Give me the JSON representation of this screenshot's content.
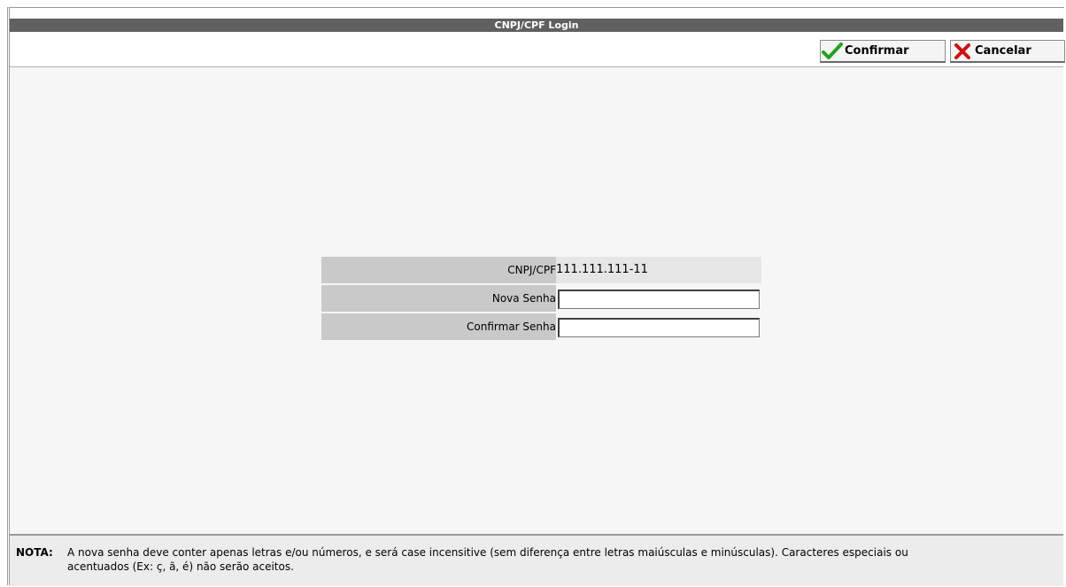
{
  "window": {
    "title": "CNPJ/CPF Login"
  },
  "toolbar": {
    "confirm_label": "Confirmar",
    "cancel_label": "Cancelar",
    "confirm_icon": "check-icon",
    "cancel_icon": "x-icon",
    "confirm_icon_color": "#1fa31f",
    "cancel_icon_color": "#cc1111"
  },
  "form": {
    "cnpj_label": "CNPJ/CPF",
    "cnpj_value": "111.111.111-11",
    "new_password_label": "Nova Senha",
    "new_password_value": "",
    "confirm_password_label": "Confirmar Senha",
    "confirm_password_value": ""
  },
  "footer": {
    "nota_label": "NOTA:",
    "nota_text": "A nova senha deve conter apenas letras e/ou números, e será case incensitive (sem diferença entre letras maiúsculas e minúsculas). Caracteres especiais ou acentuados (Ex: ç, ã, é) não serão aceitos."
  },
  "colors": {
    "titlebar_bg": "#606060",
    "label_bg": "#c9c9c9",
    "value_bg": "#e6e6e6",
    "content_bg": "#f6f6f6",
    "footer_bg": "#ececec"
  }
}
